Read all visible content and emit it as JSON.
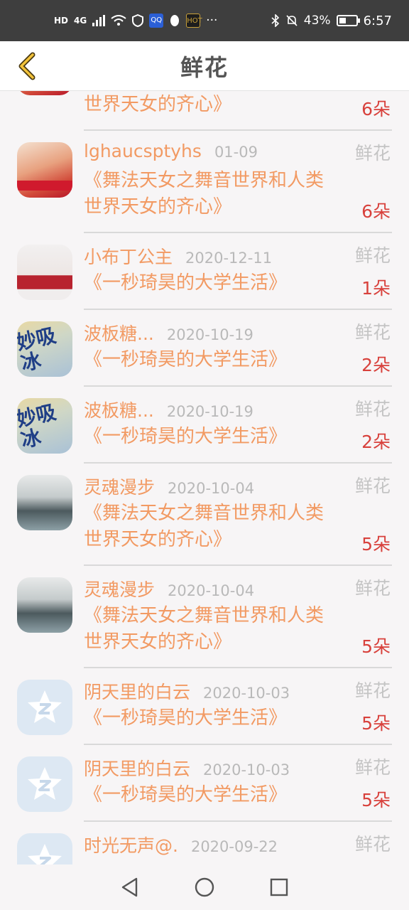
{
  "status_bar": {
    "left_icons": [
      "HD",
      "4G"
    ],
    "badge_1": "HD",
    "badge_2": "4G",
    "mini_1": "QQ",
    "mini_2": "HOT",
    "more": "···",
    "battery": "43%",
    "time": "6:57"
  },
  "header": {
    "title": "鲜花"
  },
  "items": [
    {
      "avatar": "person",
      "username": "",
      "date": "",
      "type": "",
      "book": "《舞法天女之舞音世界和人类世界天女的齐心》",
      "qty": "6朵"
    },
    {
      "avatar": "person",
      "username": "lghaucsptyhs",
      "date": "01-09",
      "type": "鲜花",
      "book": "《舞法天女之舞音世界和人类世界天女的齐心》",
      "qty": "6朵"
    },
    {
      "avatar": "person2",
      "username": "小布丁公主",
      "date": "2020-12-11",
      "type": "鲜花",
      "book": "《一秒琦昊的大学生活》",
      "qty": "1朵"
    },
    {
      "avatar": "ice",
      "username": "波板糖...",
      "date": "2020-10-19",
      "type": "鲜花",
      "book": "《一秒琦昊的大学生活》",
      "qty": "2朵"
    },
    {
      "avatar": "ice",
      "username": "波板糖...",
      "date": "2020-10-19",
      "type": "鲜花",
      "book": "《一秒琦昊的大学生活》",
      "qty": "2朵"
    },
    {
      "avatar": "rock",
      "username": "灵魂漫步",
      "date": "2020-10-04",
      "type": "鲜花",
      "book": "《舞法天女之舞音世界和人类世界天女的齐心》",
      "qty": "5朵"
    },
    {
      "avatar": "rock",
      "username": "灵魂漫步",
      "date": "2020-10-04",
      "type": "鲜花",
      "book": "《舞法天女之舞音世界和人类世界天女的齐心》",
      "qty": "5朵"
    },
    {
      "avatar": "default",
      "username": "阴天里的白云",
      "date": "2020-10-03",
      "type": "鲜花",
      "book": "《一秒琦昊的大学生活》",
      "qty": "5朵"
    },
    {
      "avatar": "default",
      "username": "阴天里的白云",
      "date": "2020-10-03",
      "type": "鲜花",
      "book": "《一秒琦昊的大学生活》",
      "qty": "5朵"
    },
    {
      "avatar": "default",
      "username": "时光无声@.",
      "date": "2020-09-22",
      "type": "鲜花",
      "book": "",
      "qty": ""
    }
  ],
  "avatar_text": {
    "ice": "妙吸冰"
  },
  "colors": {
    "accent": "#f29a63",
    "qty": "#d8413c",
    "muted": "#c4c4c4"
  },
  "icons": {
    "back": "chevron-left-icon",
    "nav_back": "triangle-back-icon",
    "nav_home": "circle-home-icon",
    "nav_recent": "square-recent-icon"
  }
}
